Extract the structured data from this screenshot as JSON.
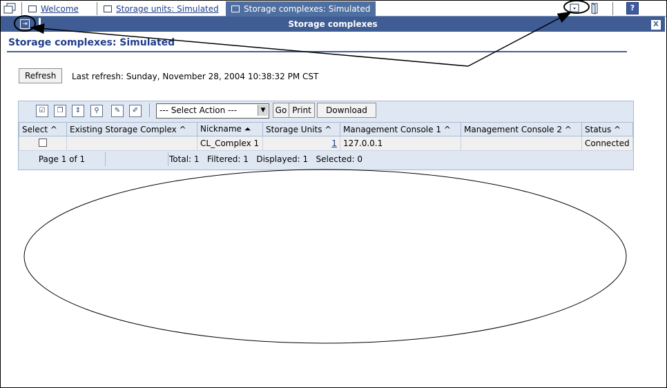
{
  "tabs": [
    {
      "label": "Welcome",
      "active": false
    },
    {
      "label": "Storage units: Simulated",
      "active": false
    },
    {
      "label": "Storage complexes: Simulated",
      "active": true
    }
  ],
  "help_label": "?",
  "portlet": {
    "title": "Storage complexes",
    "close_label": "X",
    "collapse_label": "⇥"
  },
  "page": {
    "heading": "Storage complexes: Simulated",
    "refresh_button": "Refresh",
    "last_refresh": "Last refresh: Sunday, November 28, 2004 10:38:32 PM CST"
  },
  "toolbar": {
    "icons": [
      "select-all-icon",
      "deselect-all-icon",
      "expand-icon",
      "filter-icon",
      "edit-icon",
      "clear-icon"
    ],
    "select_action": "--- Select Action ---",
    "go": "Go",
    "print": "Print",
    "download": "Download"
  },
  "table": {
    "columns": [
      "Select ^",
      "Existing Storage Complex ^",
      "Nickname ⏶",
      "Storage Units ^",
      "Management Console 1 ^",
      "Management Console 2 ^",
      "Status ^"
    ],
    "rows": [
      {
        "existing": "",
        "nickname": "CL_Complex 1",
        "storage_units": "1",
        "mc1": "127.0.0.1",
        "mc2": "",
        "status": "Connected"
      }
    ],
    "footer": {
      "page": "Page 1 of 1",
      "summary": "Total: 1   Filtered: 1   Displayed: 1   Selected: 0"
    }
  }
}
